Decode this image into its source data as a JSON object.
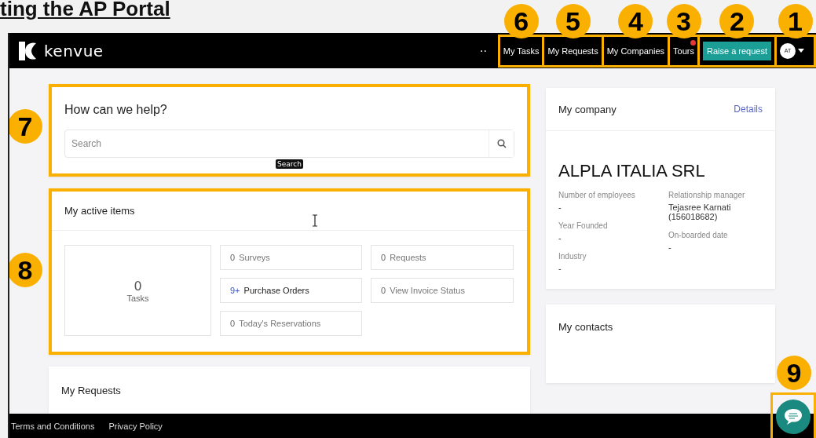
{
  "slide_title": "ting the AP Portal",
  "nav": {
    "brand": "kenvue",
    "more": "··",
    "items": [
      {
        "kind": "link",
        "label": "My Tasks",
        "callout": "6"
      },
      {
        "kind": "link",
        "label": "My Requests",
        "callout": "5"
      },
      {
        "kind": "link",
        "label": "My Companies",
        "callout": "4"
      },
      {
        "kind": "link",
        "label": "Tours",
        "notification": true,
        "callout": "3"
      },
      {
        "kind": "button",
        "label": "Raise a request",
        "callout": "2"
      },
      {
        "kind": "avatar",
        "label": "AT",
        "callout": "1"
      }
    ]
  },
  "help_card": {
    "callout": "7",
    "title": "How can we help?",
    "search": {
      "placeholder": "Search"
    },
    "tooltip": "Search"
  },
  "active_items": {
    "callout": "8",
    "title": "My active items",
    "tasks": {
      "count": "0",
      "label": "Tasks"
    },
    "items": [
      {
        "count": "0",
        "label": "Surveys",
        "highlighted": false
      },
      {
        "count": "0",
        "label": "Requests",
        "highlighted": false
      },
      {
        "count": "9+",
        "label": "Purchase Orders",
        "highlighted": true
      },
      {
        "count": "0",
        "label": "View Invoice Status",
        "highlighted": false
      },
      {
        "count": "0",
        "label": "Today's Reservations",
        "highlighted": false
      }
    ]
  },
  "requests_card": {
    "title": "My Requests"
  },
  "company_card": {
    "title": "My company",
    "link": "Details",
    "name": "ALPLA ITALIA SRL",
    "fields_left": [
      {
        "label": "Number of employees",
        "value": "-"
      },
      {
        "label": "Year Founded",
        "value": "-"
      },
      {
        "label": "Industry",
        "value": "-"
      }
    ],
    "fields_right": [
      {
        "label": "Relationship manager",
        "value": "Tejasree Karnati (156018682)"
      },
      {
        "label": "On-boarded date",
        "value": "-"
      }
    ]
  },
  "contacts_card": {
    "title": "My contacts"
  },
  "footer": {
    "links": [
      "Terms and Conditions",
      "Privacy Policy"
    ]
  },
  "chat": {
    "callout": "9"
  }
}
